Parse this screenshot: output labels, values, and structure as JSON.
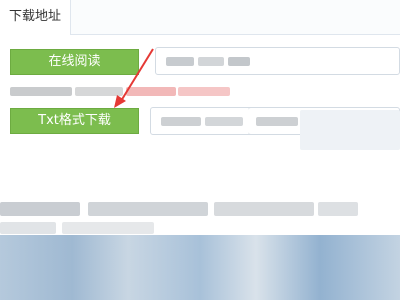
{
  "panel": {
    "tab_title": "下载地址"
  },
  "buttons": {
    "read_online": "在线阅读",
    "txt_download": "Txt格式下载"
  },
  "colors": {
    "button_green": "#7cbd4e",
    "annotation_arrow": "#e53935",
    "panel_border": "#d9e4ef"
  },
  "icons": {
    "annotation": "red-arrow-icon"
  }
}
